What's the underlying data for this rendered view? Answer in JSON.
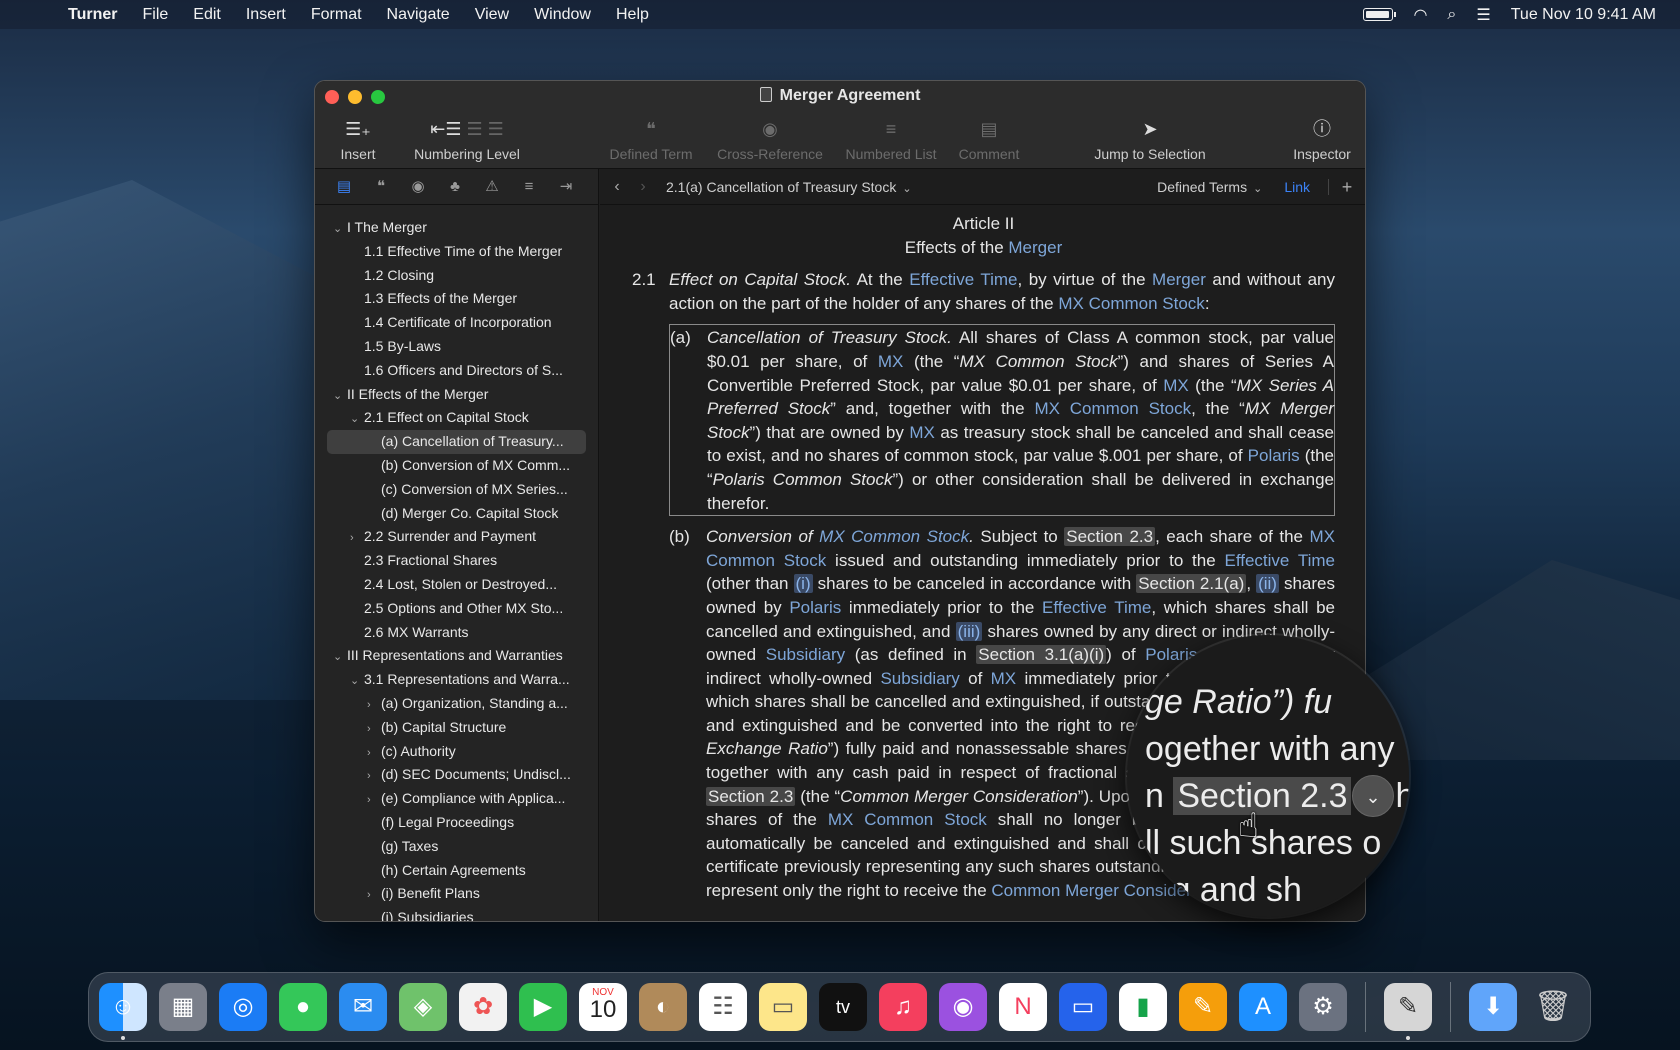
{
  "menubar": {
    "app": "Turner",
    "items": [
      "File",
      "Edit",
      "Insert",
      "Format",
      "Navigate",
      "View",
      "Window",
      "Help"
    ],
    "datetime": "Tue Nov 10  9:41 AM"
  },
  "window": {
    "title": "Merger Agreement"
  },
  "toolbar": {
    "insert": "Insert",
    "numbering_level": "Numbering Level",
    "defined_term": "Defined Term",
    "cross_reference": "Cross-Reference",
    "numbered_list": "Numbered List",
    "comment": "Comment",
    "jump_to_selection": "Jump to Selection",
    "inspector": "Inspector"
  },
  "navbar": {
    "breadcrumb": "2.1(a) Cancellation of Treasury Stock",
    "defined_terms": "Defined Terms",
    "link": "Link"
  },
  "outline": [
    {
      "label": "I The Merger",
      "indent": 0,
      "chev": "⌄"
    },
    {
      "label": "1.1 Effective Time of the Merger",
      "indent": 1,
      "chev": ""
    },
    {
      "label": "1.2 Closing",
      "indent": 1,
      "chev": ""
    },
    {
      "label": "1.3 Effects of the Merger",
      "indent": 1,
      "chev": ""
    },
    {
      "label": "1.4 Certificate of Incorporation",
      "indent": 1,
      "chev": ""
    },
    {
      "label": "1.5 By-Laws",
      "indent": 1,
      "chev": ""
    },
    {
      "label": "1.6 Officers and Directors of S...",
      "indent": 1,
      "chev": ""
    },
    {
      "label": "II Effects of the Merger",
      "indent": 0,
      "chev": "⌄"
    },
    {
      "label": "2.1 Effect on Capital Stock",
      "indent": 1,
      "chev": "⌄"
    },
    {
      "label": "(a) Cancellation of Treasury...",
      "indent": 2,
      "chev": "",
      "selected": true
    },
    {
      "label": "(b) Conversion of MX Comm...",
      "indent": 2,
      "chev": ""
    },
    {
      "label": "(c) Conversion of MX Series...",
      "indent": 2,
      "chev": ""
    },
    {
      "label": "(d) Merger Co. Capital Stock",
      "indent": 2,
      "chev": ""
    },
    {
      "label": "2.2 Surrender and Payment",
      "indent": 1,
      "chev": "›"
    },
    {
      "label": "2.3 Fractional Shares",
      "indent": 1,
      "chev": ""
    },
    {
      "label": "2.4 Lost, Stolen or Destroyed...",
      "indent": 1,
      "chev": ""
    },
    {
      "label": "2.5 Options and Other MX Sto...",
      "indent": 1,
      "chev": ""
    },
    {
      "label": "2.6 MX Warrants",
      "indent": 1,
      "chev": ""
    },
    {
      "label": "III Representations and Warranties",
      "indent": 0,
      "chev": "⌄"
    },
    {
      "label": "3.1 Representations and Warra...",
      "indent": 1,
      "chev": "⌄"
    },
    {
      "label": "(a) Organization, Standing a...",
      "indent": 2,
      "chev": "›"
    },
    {
      "label": "(b) Capital Structure",
      "indent": 2,
      "chev": "›"
    },
    {
      "label": "(c) Authority",
      "indent": 2,
      "chev": "›"
    },
    {
      "label": "(d) SEC Documents; Undiscl...",
      "indent": 2,
      "chev": "›"
    },
    {
      "label": "(e) Compliance with Applica...",
      "indent": 2,
      "chev": "›"
    },
    {
      "label": "(f) Legal Proceedings",
      "indent": 2,
      "chev": ""
    },
    {
      "label": "(g) Taxes",
      "indent": 2,
      "chev": ""
    },
    {
      "label": "(h) Certain Agreements",
      "indent": 2,
      "chev": ""
    },
    {
      "label": "(i) Benefit Plans",
      "indent": 2,
      "chev": "›"
    },
    {
      "label": "(j) Subsidiaries",
      "indent": 2,
      "chev": ""
    }
  ],
  "document": {
    "article": "Article II",
    "heading_pre": "Effects of the ",
    "heading_term": "Merger",
    "p21_num": "2.1",
    "a_num": "(a)",
    "b_num": "(b)"
  },
  "magnifier": {
    "line1": "ge Ratio”) fu",
    "line2": "ogether with any",
    "line3_pre": "n ",
    "line3_sec": "Section 2.3",
    "line3_post": "he",
    "line4": "ll such shares o",
    "line5": "ing  and  sh"
  },
  "dock": {
    "calendar_month": "NOV",
    "calendar_day": "10",
    "tv_label": "tv",
    "apps": [
      "finder-icon",
      "launchpad-icon",
      "safari-icon",
      "messages-icon",
      "mail-icon",
      "maps-icon",
      "photos-icon",
      "facetime-icon",
      "calendar-icon",
      "contacts-icon",
      "reminders-icon",
      "notes-icon",
      "tv-icon",
      "music-icon",
      "podcasts-icon",
      "news-icon",
      "keynote-icon",
      "numbers-icon",
      "pages-icon",
      "app-store-icon",
      "system-preferences-icon",
      "turner-icon",
      "downloads-icon",
      "trash-icon"
    ]
  }
}
